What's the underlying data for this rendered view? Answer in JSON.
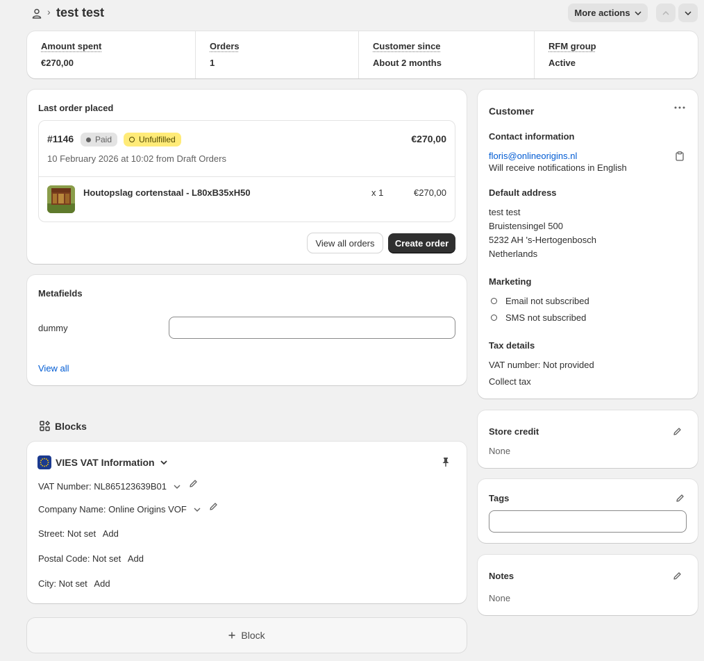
{
  "header": {
    "breadcrumb_sep": "›",
    "title": "test test",
    "more_actions": "More actions"
  },
  "stats": [
    {
      "label": "Amount spent",
      "value": "€270,00"
    },
    {
      "label": "Orders",
      "value": "1"
    },
    {
      "label": "Customer since",
      "value": "About 2 months"
    },
    {
      "label": "RFM group",
      "value": "Active"
    }
  ],
  "last_order": {
    "heading": "Last order placed",
    "number": "#1146",
    "payment_badge": "Paid",
    "fulfillment_badge": "Unfulfilled",
    "total": "€270,00",
    "meta": "10 February 2026 at 10:02 from Draft Orders",
    "item_name": "Houtopslag cortenstaal - L80xB35xH50",
    "item_qty": "x 1",
    "item_price": "€270,00",
    "view_all_orders": "View all orders",
    "create_order": "Create order"
  },
  "metafields": {
    "heading": "Metafields",
    "field_label": "dummy",
    "field_value": "",
    "view_all": "View all"
  },
  "blocks": {
    "heading": "Blocks",
    "app_title": "VIES VAT Information",
    "vat_number": "VAT Number: NL865123639B01",
    "company_name": "Company Name: Online Origins VOF",
    "street": "Street: Not set",
    "postal_code": "Postal Code: Not set",
    "city": "City: Not set",
    "add_label": "Add",
    "add_block": "Block"
  },
  "customer": {
    "heading": "Customer",
    "contact_heading": "Contact information",
    "email": "floris@onlineorigins.nl",
    "notification_lang": "Will receive notifications in English",
    "address_heading": "Default address",
    "address_lines": [
      "test test",
      "Bruistensingel 500",
      "5232 AH 's-Hertogenbosch",
      "Netherlands"
    ],
    "marketing_heading": "Marketing",
    "email_marketing": "Email not subscribed",
    "sms_marketing": "SMS not subscribed",
    "tax_heading": "Tax details",
    "vat_number": "VAT number: Not provided",
    "collect_tax": "Collect tax"
  },
  "store_credit": {
    "heading": "Store credit",
    "value": "None"
  },
  "tags": {
    "heading": "Tags",
    "value": ""
  },
  "notes": {
    "heading": "Notes",
    "value": "None"
  },
  "colors": {
    "link": "#005bd3",
    "unfulfilled_badge": "#ffeb78",
    "paid_badge": "#e3e3e3",
    "primary_button": "#303030",
    "eu_flag": "#1b3a8f"
  }
}
